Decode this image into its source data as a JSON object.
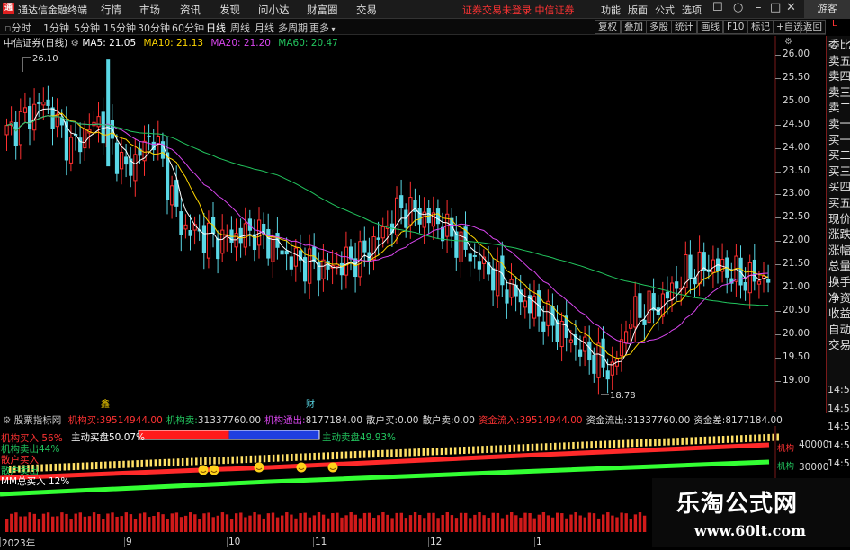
{
  "app": {
    "title": "通达信金融终端",
    "menus": [
      "行情",
      "市场",
      "资讯",
      "发现",
      "问小达",
      "财富圈",
      "交易"
    ],
    "notice": "证券交易未登录 中信证券",
    "right_menus": [
      "功能",
      "版面",
      "公式",
      "选项"
    ],
    "window_controls": [
      "☐",
      "○",
      "–",
      "□",
      "✕"
    ],
    "guest": "游客"
  },
  "toolbar": {
    "periods": [
      "分时",
      "1分钟",
      "5分钟",
      "15分钟",
      "30分钟",
      "60分钟",
      "日线",
      "周线",
      "月线",
      "多周期",
      "更多"
    ],
    "buttons": [
      "复权",
      "叠加",
      "多股",
      "统计",
      "画线",
      "F10",
      "标记",
      "+自选",
      "返回"
    ]
  },
  "chart": {
    "stock_name": "中信证券(日线)",
    "ma_labels": [
      {
        "text": "MA5: 21.05",
        "color": "#ffffff"
      },
      {
        "text": "MA10: 21.13",
        "color": "#ffd700"
      },
      {
        "text": "MA20: 21.20",
        "color": "#d946ef"
      },
      {
        "text": "MA60: 20.47",
        "color": "#22c55e"
      }
    ],
    "price_ticks": [
      "26.00",
      "25.50",
      "25.00",
      "24.50",
      "24.00",
      "23.50",
      "23.00",
      "22.50",
      "22.00",
      "21.50",
      "21.00",
      "20.50",
      "20.00",
      "19.50",
      "19.00"
    ],
    "high_label": "26.10",
    "low_label": "18.78",
    "markers": [
      "鑫",
      "财"
    ],
    "up_color": "#ff3030",
    "down_color": "#5ad8e6"
  },
  "right_panel": {
    "items": [
      "委比",
      "卖五",
      "卖四",
      "卖三",
      "卖二",
      "卖一",
      "买一",
      "买二",
      "买三",
      "买四",
      "买五",
      "现价",
      "涨跌",
      "涨幅",
      "总量",
      "换手",
      "净资",
      "收益",
      "自动",
      "交易"
    ],
    "lower_ticks": [
      "14:5",
      "14:5",
      "14:5",
      "14:5",
      "14:5"
    ],
    "corner": "L"
  },
  "indicator": {
    "name": "股票指标网",
    "fields": [
      {
        "label": "机构买:",
        "value": "39514944.00",
        "label_color": "#ff3333",
        "value_color": "#ff3333"
      },
      {
        "label": "机构卖:",
        "value": "31337760.00",
        "label_color": "#22c55e",
        "value_color": "#d8d8d8"
      },
      {
        "label": "机构通出:",
        "value": "8177184.00",
        "label_color": "#d946ef",
        "value_color": "#d8d8d8"
      },
      {
        "label": "散户买:",
        "value": "0.00",
        "label_color": "#d8d8d8",
        "value_color": "#d8d8d8"
      },
      {
        "label": "散户卖:",
        "value": "0.00",
        "label_color": "#d8d8d8",
        "value_color": "#d8d8d8"
      },
      {
        "label": "资金流入:",
        "value": "39514944.00",
        "label_color": "#ff3333",
        "value_color": "#ff3333"
      },
      {
        "label": "资金流出:",
        "value": "31337760.00",
        "label_color": "#d8d8d8",
        "value_color": "#d8d8d8"
      },
      {
        "label": "资金差:",
        "value": "8177184.00",
        "label_color": "#d8d8d8",
        "value_color": "#d8d8d8"
      }
    ],
    "buy_label": "主动买盘50.07%",
    "sell_label": "主动卖盘49.93%",
    "buy_ratio": 0.5007,
    "left_labels": [
      {
        "text": "机构买入 56%",
        "color": "#ff3333"
      },
      {
        "text": "机构卖出44%",
        "color": "#22c55e"
      },
      {
        "text": "散户买入",
        "color": "#ff3333"
      },
      {
        "text": "散户卖出",
        "color": "#22c55e"
      },
      {
        "text": "MM总买入 12%",
        "color": "#ffffff"
      }
    ],
    "y_ticks": [
      "40000",
      "30000"
    ],
    "line_labels": [
      "机构",
      "机构"
    ],
    "smiley_count": 6
  },
  "dates": [
    "2023年",
    "9",
    "10",
    "11",
    "12",
    "1"
  ],
  "watermark": {
    "title": "乐淘公式网",
    "url": "www.60lt.com"
  }
}
